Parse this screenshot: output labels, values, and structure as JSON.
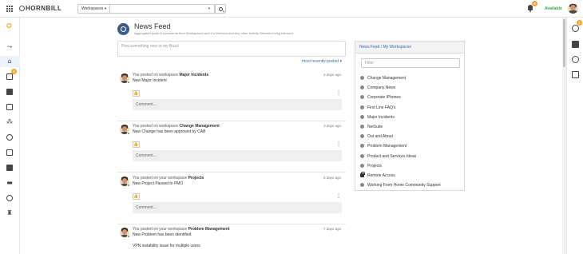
{
  "header": {
    "logo_text": "HORNBILL",
    "workspace_select": "Workspaces",
    "notification_count": "9",
    "status": "Available"
  },
  "leftnav": {
    "mail_badge": "5"
  },
  "rightrail": {
    "tasks_badge": "1"
  },
  "feed": {
    "title": "News Feed",
    "subtitle": "Aggregated posts & comments from Workspaces and Co-Workers and any other Activity Streams being followed",
    "post_placeholder": "Post something new to my Buzz!",
    "sort_label": "most recently posted",
    "comment_placeholder": "Comment...",
    "posts": [
      {
        "prefix": "You posted on workspace",
        "workspace": "Major Incidents",
        "text": "New Major Incident",
        "time": "2 days ago"
      },
      {
        "prefix": "You posted on workspace",
        "workspace": "Change Management",
        "text": "New Change has been approved by CAB",
        "time": "3 days ago"
      },
      {
        "prefix": "You posted on your workspace",
        "workspace": "Projects",
        "text": "New Project Passed to PMO",
        "time": "6 days ago"
      },
      {
        "prefix": "You posted on your workspace",
        "workspace": "Problem Management",
        "text": "New Problem has been identified",
        "time": "7 days ago",
        "extra": "VPN instability issue for multiple users"
      }
    ]
  },
  "workspaces_panel": {
    "title": "News Feed / My Workspaces",
    "filter_placeholder": "Filter",
    "items": [
      "Change Management",
      "Company News",
      "Corporate iPhones",
      "First Line FAQ's",
      "Major Incidents",
      "NetSuite",
      "Out and About",
      "Problem Management",
      "Product and Services Ideas",
      "Projects",
      "Remote Access",
      "Working From Home Community Support"
    ]
  },
  "colors": {
    "accent": "#3b6bb0",
    "badge": "#f0a830",
    "available": "#3aa655"
  }
}
